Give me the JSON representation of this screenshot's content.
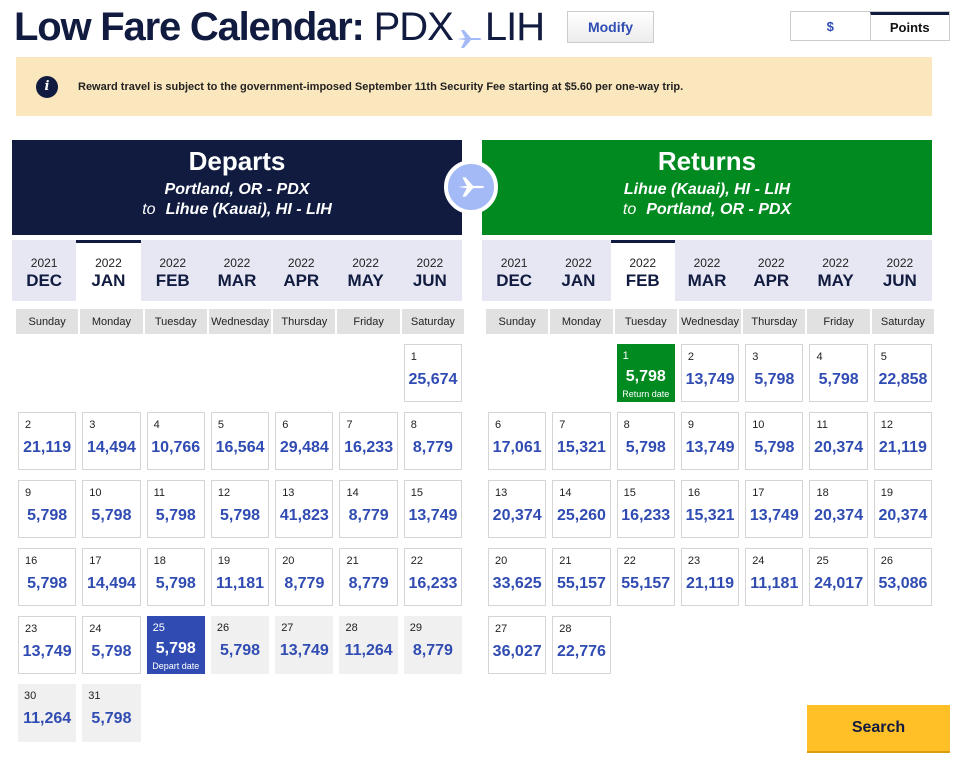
{
  "header": {
    "title": "Low Fare Calendar:",
    "origin": "PDX",
    "destination": "LIH",
    "modify_label": "Modify"
  },
  "currency_toggle": {
    "dollar_label": "$",
    "points_label": "Points",
    "selected": "Points"
  },
  "notice": {
    "text": "Reward travel is subject to the government-imposed September 11th Security Fee starting at $5.60 per one-way trip."
  },
  "departs": {
    "heading": "Departs",
    "from": "Portland, OR - PDX",
    "to_word": "to",
    "to": "Lihue (Kauai), HI - LIH",
    "months": [
      {
        "year": "2021",
        "month": "DEC"
      },
      {
        "year": "2022",
        "month": "JAN",
        "active": true
      },
      {
        "year": "2022",
        "month": "FEB"
      },
      {
        "year": "2022",
        "month": "MAR"
      },
      {
        "year": "2022",
        "month": "APR"
      },
      {
        "year": "2022",
        "month": "MAY"
      },
      {
        "year": "2022",
        "month": "JUN"
      }
    ],
    "weekdays": [
      "Sunday",
      "Monday",
      "Tuesday",
      "Wednesday",
      "Thursday",
      "Friday",
      "Saturday"
    ],
    "first_weekday": 6,
    "days": [
      {
        "d": "1",
        "p": "25,674"
      },
      {
        "d": "2",
        "p": "21,119"
      },
      {
        "d": "3",
        "p": "14,494"
      },
      {
        "d": "4",
        "p": "10,766"
      },
      {
        "d": "5",
        "p": "16,564"
      },
      {
        "d": "6",
        "p": "29,484"
      },
      {
        "d": "7",
        "p": "16,233"
      },
      {
        "d": "8",
        "p": "8,779"
      },
      {
        "d": "9",
        "p": "5,798"
      },
      {
        "d": "10",
        "p": "5,798"
      },
      {
        "d": "11",
        "p": "5,798"
      },
      {
        "d": "12",
        "p": "5,798"
      },
      {
        "d": "13",
        "p": "41,823"
      },
      {
        "d": "14",
        "p": "8,779"
      },
      {
        "d": "15",
        "p": "13,749"
      },
      {
        "d": "16",
        "p": "5,798"
      },
      {
        "d": "17",
        "p": "14,494"
      },
      {
        "d": "18",
        "p": "5,798"
      },
      {
        "d": "19",
        "p": "11,181"
      },
      {
        "d": "20",
        "p": "8,779"
      },
      {
        "d": "21",
        "p": "8,779"
      },
      {
        "d": "22",
        "p": "16,233"
      },
      {
        "d": "23",
        "p": "13,749"
      },
      {
        "d": "24",
        "p": "5,798"
      },
      {
        "d": "25",
        "p": "5,798",
        "selected": true,
        "tag": "Depart date"
      },
      {
        "d": "26",
        "p": "5,798",
        "grey": true
      },
      {
        "d": "27",
        "p": "13,749",
        "grey": true
      },
      {
        "d": "28",
        "p": "11,264",
        "grey": true
      },
      {
        "d": "29",
        "p": "8,779",
        "grey": true
      },
      {
        "d": "30",
        "p": "11,264",
        "grey": true
      },
      {
        "d": "31",
        "p": "5,798",
        "grey": true
      }
    ]
  },
  "returns": {
    "heading": "Returns",
    "from": "Lihue (Kauai), HI - LIH",
    "to_word": "to",
    "to": "Portland, OR - PDX",
    "months": [
      {
        "year": "2021",
        "month": "DEC"
      },
      {
        "year": "2022",
        "month": "JAN"
      },
      {
        "year": "2022",
        "month": "FEB",
        "active": true
      },
      {
        "year": "2022",
        "month": "MAR"
      },
      {
        "year": "2022",
        "month": "APR"
      },
      {
        "year": "2022",
        "month": "MAY"
      },
      {
        "year": "2022",
        "month": "JUN"
      }
    ],
    "weekdays": [
      "Sunday",
      "Monday",
      "Tuesday",
      "Wednesday",
      "Thursday",
      "Friday",
      "Saturday"
    ],
    "first_weekday": 2,
    "days": [
      {
        "d": "1",
        "p": "5,798",
        "selected": true,
        "tag": "Return date"
      },
      {
        "d": "2",
        "p": "13,749"
      },
      {
        "d": "3",
        "p": "5,798"
      },
      {
        "d": "4",
        "p": "5,798"
      },
      {
        "d": "5",
        "p": "22,858"
      },
      {
        "d": "6",
        "p": "17,061"
      },
      {
        "d": "7",
        "p": "15,321"
      },
      {
        "d": "8",
        "p": "5,798"
      },
      {
        "d": "9",
        "p": "13,749"
      },
      {
        "d": "10",
        "p": "5,798"
      },
      {
        "d": "11",
        "p": "20,374"
      },
      {
        "d": "12",
        "p": "21,119"
      },
      {
        "d": "13",
        "p": "20,374"
      },
      {
        "d": "14",
        "p": "25,260"
      },
      {
        "d": "15",
        "p": "16,233"
      },
      {
        "d": "16",
        "p": "15,321"
      },
      {
        "d": "17",
        "p": "13,749"
      },
      {
        "d": "18",
        "p": "20,374"
      },
      {
        "d": "19",
        "p": "20,374"
      },
      {
        "d": "20",
        "p": "33,625"
      },
      {
        "d": "21",
        "p": "55,157"
      },
      {
        "d": "22",
        "p": "55,157"
      },
      {
        "d": "23",
        "p": "21,119"
      },
      {
        "d": "24",
        "p": "11,181"
      },
      {
        "d": "25",
        "p": "24,017"
      },
      {
        "d": "26",
        "p": "53,086"
      },
      {
        "d": "27",
        "p": "36,027"
      },
      {
        "d": "28",
        "p": "22,776"
      }
    ]
  },
  "search_label": "Search",
  "colors": {
    "navy": "#111b40",
    "green": "#008a20",
    "blue": "#304cb2",
    "yellow": "#ffbf27",
    "notice": "#fbe7bd"
  }
}
